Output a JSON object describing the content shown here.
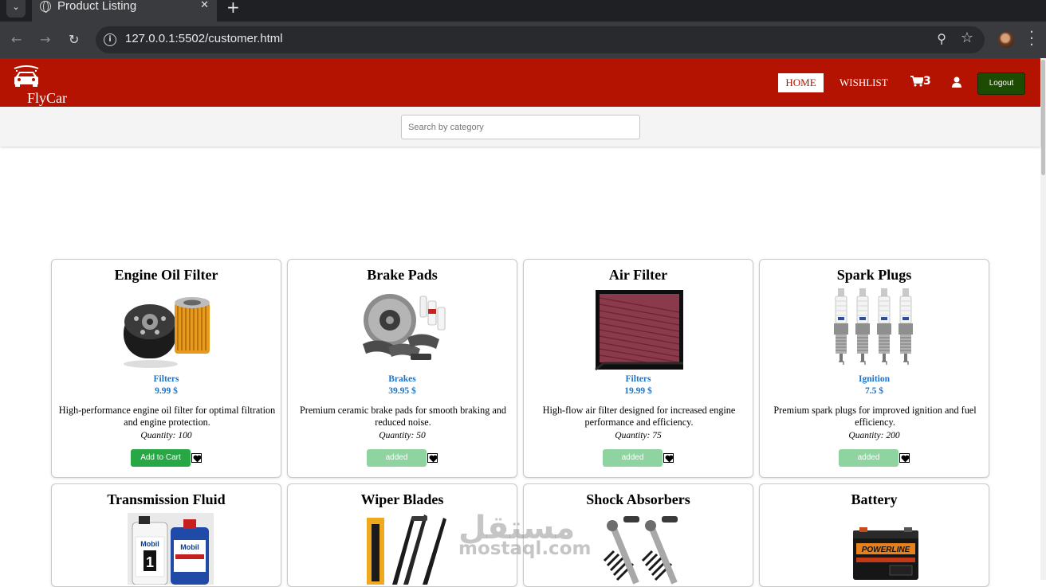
{
  "browser": {
    "tab_title": "Product Listing",
    "url": "127.0.0.1:5502/customer.html"
  },
  "header": {
    "brand": "FlyCar",
    "nav": {
      "home": "HOME",
      "wishlist": "WISHLIST"
    },
    "cart_count": "3",
    "logout": "Logout"
  },
  "search": {
    "placeholder": "Search by category",
    "value": ""
  },
  "products": [
    {
      "name": "Engine Oil Filter",
      "category": "Filters",
      "price": "9.99 $",
      "description": "High-performance engine oil filter for optimal filtration and engine protection.",
      "quantity": "Quantity: 100",
      "button": "Add to Cart",
      "button_state": "add",
      "icon": "oil-filter-image"
    },
    {
      "name": "Brake Pads",
      "category": "Brakes",
      "price": "39.95 $",
      "description": "Premium ceramic brake pads for smooth braking and reduced noise.",
      "quantity": "Quantity: 50",
      "button": "added",
      "button_state": "added",
      "icon": "brake-pads-image"
    },
    {
      "name": "Air Filter",
      "category": "Filters",
      "price": "19.99 $",
      "description": "High-flow air filter designed for increased engine performance and efficiency.",
      "quantity": "Quantity: 75",
      "button": "added",
      "button_state": "added",
      "icon": "air-filter-image"
    },
    {
      "name": "Spark Plugs",
      "category": "Ignition",
      "price": "7.5 $",
      "description": "Premium spark plugs for improved ignition and fuel efficiency.",
      "quantity": "Quantity: 200",
      "button": "added",
      "button_state": "added",
      "icon": "spark-plugs-image"
    },
    {
      "name": "Transmission Fluid",
      "icon": "transmission-fluid-image"
    },
    {
      "name": "Wiper Blades",
      "icon": "wiper-blades-image"
    },
    {
      "name": "Shock Absorbers",
      "icon": "shock-absorbers-image"
    },
    {
      "name": "Battery",
      "icon": "battery-image"
    }
  ],
  "watermark": {
    "arabic": "مستقل",
    "latin": "mostaql.com"
  },
  "colors": {
    "header_red": "#b31300",
    "logout_green": "#1d4b02",
    "add_green": "#28a745",
    "link_blue": "#1a73c8"
  }
}
